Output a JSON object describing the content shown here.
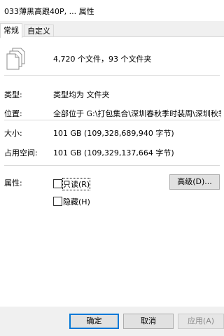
{
  "window": {
    "title": "033薄黑高跟40P, ... 属性"
  },
  "tabs": [
    {
      "label": "常规"
    },
    {
      "label": "自定义"
    }
  ],
  "general": {
    "summary": "4,720 个文件，93 个文件夹",
    "type_label": "类型:",
    "type_value": "类型均为 文件夹",
    "location_label": "位置:",
    "location_value": "全部位于 G:\\打包集合\\深圳春秋季时装周\\深圳秋季时装",
    "size_label": "大小:",
    "size_value": "101 GB (109,328,689,940 字节)",
    "disk_size_label": "占用空间:",
    "disk_size_value": "101 GB (109,329,137,664 字节)",
    "attributes_label": "属性:",
    "readonly_label": "只读(R)",
    "hidden_label": "隐藏(H)",
    "advanced_button": "高级(D)..."
  },
  "buttons": {
    "ok": "确定",
    "cancel": "取消",
    "apply": "应用(A)"
  },
  "icons": {
    "files": "multiple-files-icon"
  }
}
